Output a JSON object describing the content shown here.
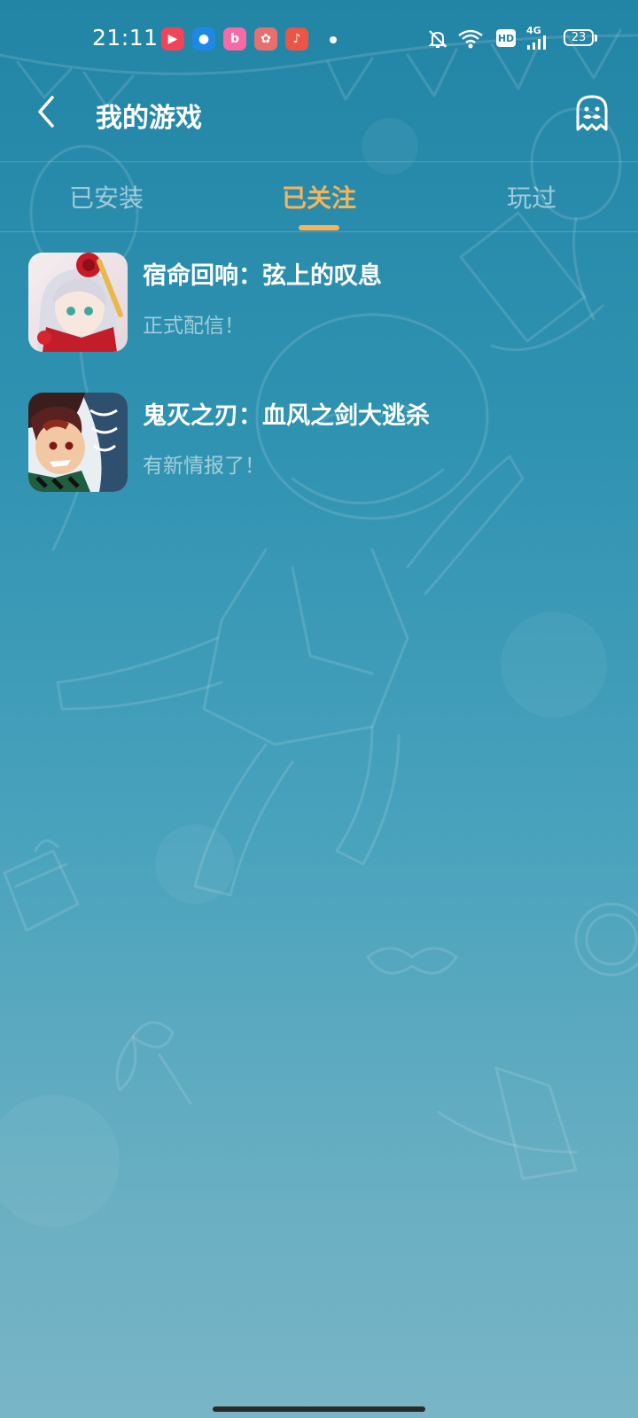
{
  "status_bar": {
    "time": "21:11",
    "notification_apps": [
      {
        "name": "video-app-icon",
        "glyph": "▶",
        "color": "#f0445a"
      },
      {
        "name": "circle-app-icon",
        "glyph": "●",
        "color": "#1e88e5"
      },
      {
        "name": "bilibili-app-icon",
        "glyph": "b",
        "color": "#f76aa5"
      },
      {
        "name": "palette-app-icon",
        "glyph": "✿",
        "color": "#e86f6f"
      },
      {
        "name": "music-app-icon",
        "glyph": "♪",
        "color": "#ea5545"
      }
    ],
    "hd_label": "HD",
    "network_label": "4G",
    "battery_level": "23"
  },
  "header": {
    "title": "我的游戏"
  },
  "tabs": [
    {
      "label": "已安装",
      "active": false
    },
    {
      "label": "已关注",
      "active": true
    },
    {
      "label": "玩过",
      "active": false
    }
  ],
  "games": [
    {
      "name": "宿命回响：弦上的叹息",
      "status": "正式配信！"
    },
    {
      "name": "鬼灭之刃：血风之剑大逃杀",
      "status": "有新情报了！"
    }
  ],
  "colors": {
    "accent": "#f5b35a",
    "background_top": "#2385a6",
    "background_bottom": "#78b5c7"
  }
}
